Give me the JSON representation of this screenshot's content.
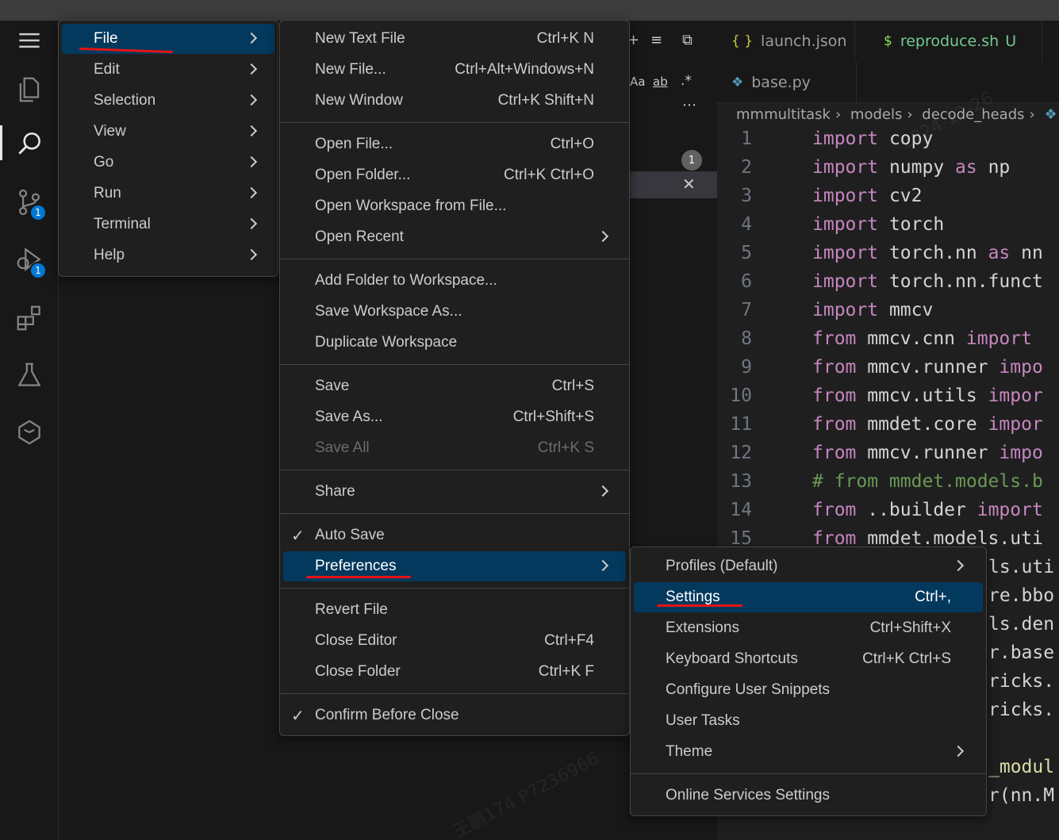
{
  "activity_bar": {
    "items": [
      {
        "name": "menu-icon"
      },
      {
        "name": "explorer-icon"
      },
      {
        "name": "search-icon"
      },
      {
        "name": "source-control-icon",
        "badge": "1"
      },
      {
        "name": "run-debug-icon",
        "badge": "1"
      },
      {
        "name": "extensions-icon"
      },
      {
        "name": "testing-icon"
      },
      {
        "name": "remote-icon"
      }
    ]
  },
  "side_panel": {
    "result_count": "1",
    "search_options": [
      "Aa",
      "ab",
      ".*"
    ]
  },
  "tabs_row1": [
    {
      "icon": "{ }",
      "label": "launch.json"
    },
    {
      "icon": "$",
      "label": "reproduce.sh",
      "status": "U"
    }
  ],
  "tabs_row2": [
    {
      "label": "base.py"
    }
  ],
  "breadcrumb": [
    "mmmultitask",
    "models",
    "decode_heads"
  ],
  "code_lines": [
    {
      "n": "1",
      "kw": "import",
      "rest": " copy"
    },
    {
      "n": "2",
      "kw": "import",
      "rest": " numpy ",
      "kw2": "as",
      "rest2": " np"
    },
    {
      "n": "3",
      "kw": "import",
      "rest": " cv2"
    },
    {
      "n": "4",
      "kw": "import",
      "rest": " torch"
    },
    {
      "n": "5",
      "kw": "import",
      "rest": " torch.nn ",
      "kw2": "as",
      "rest2": " nn"
    },
    {
      "n": "6",
      "kw": "import",
      "rest": " torch.nn.funct"
    },
    {
      "n": "7",
      "kw": "import",
      "rest": " mmcv"
    },
    {
      "n": "8",
      "kw": "from",
      "rest": " mmcv.cnn ",
      "kw2": "import",
      "rest2": ""
    },
    {
      "n": "9",
      "kw": "from",
      "rest": " mmcv.runner ",
      "kw2": "impo",
      "rest2": ""
    },
    {
      "n": "10",
      "kw": "from",
      "rest": " mmcv.utils ",
      "kw2": "impor",
      "rest2": ""
    },
    {
      "n": "11",
      "kw": "from",
      "rest": " mmdet.core ",
      "kw2": "impor",
      "rest2": ""
    },
    {
      "n": "12",
      "kw": "from",
      "rest": " mmcv.runner ",
      "kw2": "impo",
      "rest2": ""
    },
    {
      "n": "13",
      "comment": "# from mmdet.models.b"
    },
    {
      "n": "14",
      "kw": "from",
      "rest": " ..builder ",
      "kw2": "import",
      "rest2": ""
    },
    {
      "n": "15",
      "kw": "from",
      "rest": " mmdet.models.uti"
    }
  ],
  "code_fragments": [
    "ls.uti",
    "re.bbo",
    "ls.den",
    "r.base",
    "ricks.",
    "ricks.",
    "_modul",
    "r(nn.M"
  ],
  "main_menu": {
    "items": [
      {
        "label": "File",
        "selected": true
      },
      {
        "label": "Edit"
      },
      {
        "label": "Selection"
      },
      {
        "label": "View"
      },
      {
        "label": "Go"
      },
      {
        "label": "Run"
      },
      {
        "label": "Terminal"
      },
      {
        "label": "Help"
      }
    ]
  },
  "file_menu": {
    "groups": [
      [
        {
          "label": "New Text File",
          "shortcut": "Ctrl+K N"
        },
        {
          "label": "New File...",
          "shortcut": "Ctrl+Alt+Windows+N"
        },
        {
          "label": "New Window",
          "shortcut": "Ctrl+K Shift+N"
        }
      ],
      [
        {
          "label": "Open File...",
          "shortcut": "Ctrl+O"
        },
        {
          "label": "Open Folder...",
          "shortcut": "Ctrl+K Ctrl+O"
        },
        {
          "label": "Open Workspace from File...",
          "shortcut": ""
        },
        {
          "label": "Open Recent",
          "shortcut": "",
          "submenu": true
        }
      ],
      [
        {
          "label": "Add Folder to Workspace...",
          "shortcut": ""
        },
        {
          "label": "Save Workspace As...",
          "shortcut": ""
        },
        {
          "label": "Duplicate Workspace",
          "shortcut": ""
        }
      ],
      [
        {
          "label": "Save",
          "shortcut": "Ctrl+S"
        },
        {
          "label": "Save As...",
          "shortcut": "Ctrl+Shift+S"
        },
        {
          "label": "Save All",
          "shortcut": "Ctrl+K S",
          "disabled": true
        }
      ],
      [
        {
          "label": "Share",
          "shortcut": "",
          "submenu": true
        }
      ],
      [
        {
          "label": "Auto Save",
          "shortcut": "",
          "checked": true
        },
        {
          "label": "Preferences",
          "shortcut": "",
          "submenu": true,
          "selected": true
        }
      ],
      [
        {
          "label": "Revert File",
          "shortcut": ""
        },
        {
          "label": "Close Editor",
          "shortcut": "Ctrl+F4"
        },
        {
          "label": "Close Folder",
          "shortcut": "Ctrl+K F"
        }
      ],
      [
        {
          "label": "Confirm Before Close",
          "shortcut": "",
          "checked": true
        }
      ]
    ]
  },
  "preferences_menu": {
    "groups": [
      [
        {
          "label": "Profiles (Default)",
          "shortcut": "",
          "submenu": true
        },
        {
          "label": "Settings",
          "shortcut": "Ctrl+,",
          "selected": true
        },
        {
          "label": "Extensions",
          "shortcut": "Ctrl+Shift+X"
        },
        {
          "label": "Keyboard Shortcuts",
          "shortcut": "Ctrl+K Ctrl+S"
        },
        {
          "label": "Configure User Snippets",
          "shortcut": ""
        },
        {
          "label": "User Tasks",
          "shortcut": ""
        },
        {
          "label": "Theme",
          "shortcut": "",
          "submenu": true
        }
      ],
      [
        {
          "label": "Online Services Settings",
          "shortcut": ""
        }
      ]
    ]
  },
  "colors": {
    "selection": "#04395e",
    "accent_badge": "#0078d4",
    "annotation_red": "#e51414",
    "keyword": "#c586c0"
  }
}
